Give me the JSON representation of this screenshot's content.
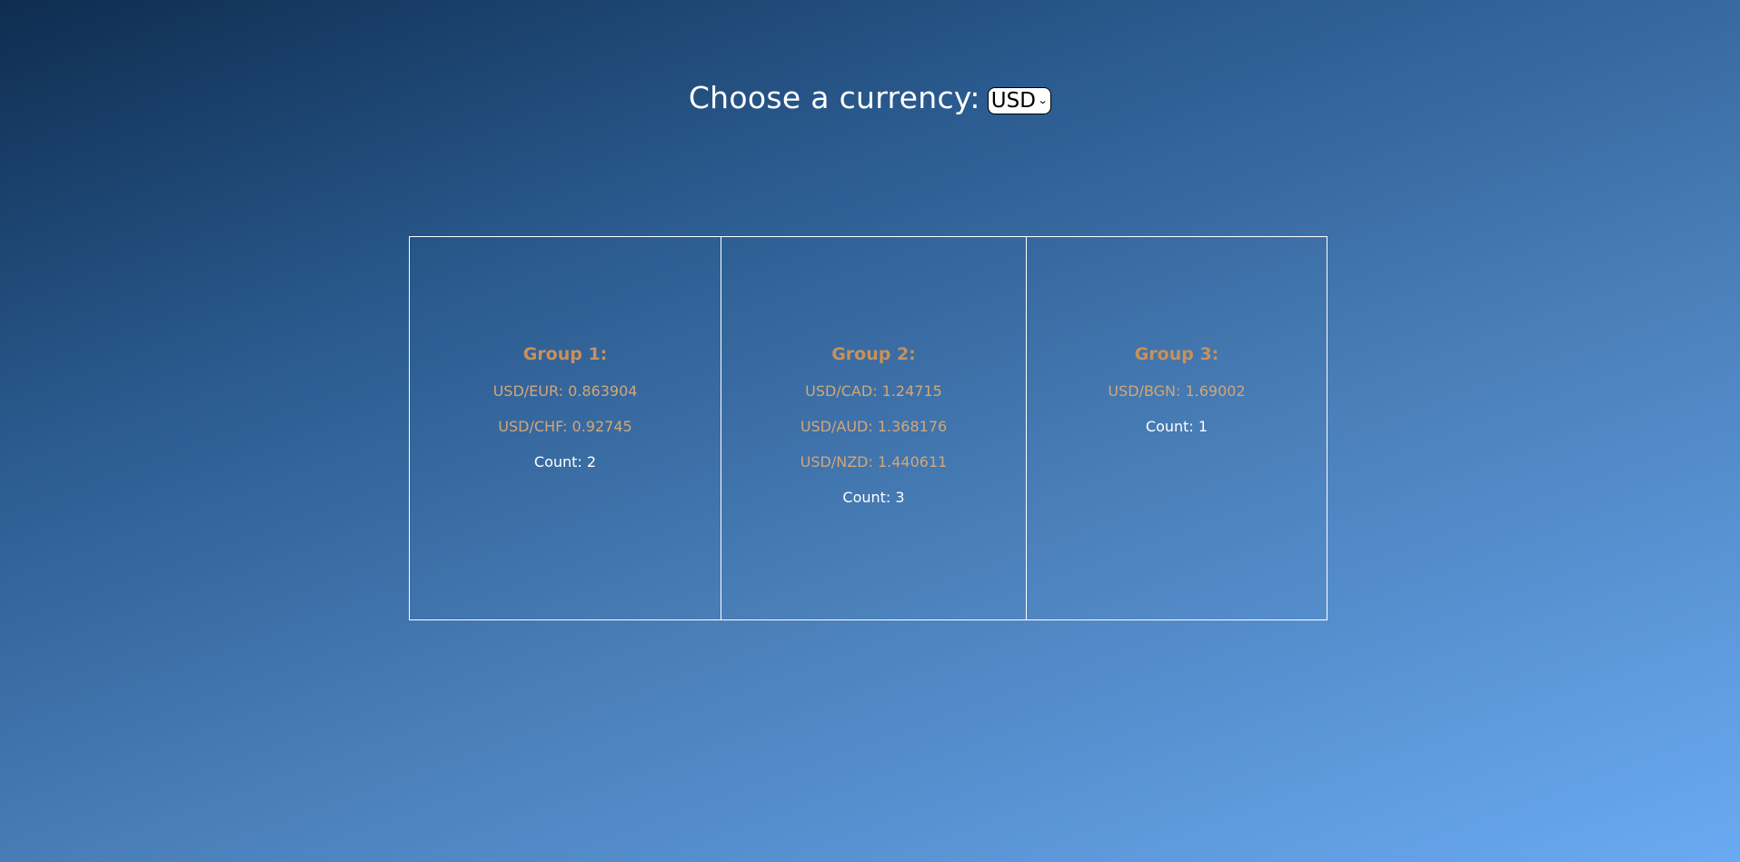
{
  "header": {
    "label": "Choose a currency:",
    "selected_currency": "USD"
  },
  "groups": [
    {
      "title": "Group 1:",
      "rates": [
        "USD/EUR: 0.863904",
        "USD/CHF: 0.92745"
      ],
      "count": "Count: 2"
    },
    {
      "title": "Group 2:",
      "rates": [
        "USD/CAD: 1.24715",
        "USD/AUD: 1.368176",
        "USD/NZD: 1.440611"
      ],
      "count": "Count: 3"
    },
    {
      "title": "Group 3:",
      "rates": [
        "USD/BGN: 1.69002"
      ],
      "count": "Count: 1"
    }
  ],
  "colors": {
    "title": "#c8915a",
    "rate": "#d4a678",
    "count": "#ffffff",
    "border": "#ffffff"
  }
}
